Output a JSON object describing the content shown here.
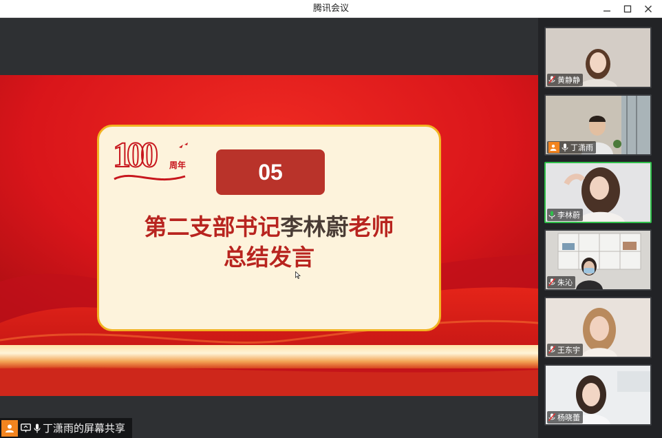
{
  "window": {
    "title": "腾讯会议",
    "controls": [
      "minimize-icon",
      "maximize-icon",
      "close-icon"
    ]
  },
  "slide": {
    "logo_number": "100",
    "logo_suffix": "周年",
    "badge": "05",
    "heading_line1_a": "第二支部书记",
    "heading_line1_b": "李林蔚",
    "heading_line1_c": "老师",
    "heading_line2": "总结发言",
    "colors": {
      "red": "#c7161d",
      "card": "#fdf3dc",
      "gold": "#f2b323",
      "badge": "#b9332a"
    }
  },
  "share": {
    "label": "丁潇雨的屏幕共享"
  },
  "participants": [
    {
      "name": "黄静静",
      "mic": "muted",
      "host": false,
      "active": false
    },
    {
      "name": "丁潇雨",
      "mic": "on",
      "host": true,
      "active": false
    },
    {
      "name": "李林蔚",
      "mic": "speaking",
      "host": false,
      "active": true
    },
    {
      "name": "朱沁",
      "mic": "muted",
      "host": false,
      "active": false
    },
    {
      "name": "王东宇",
      "mic": "muted",
      "host": false,
      "active": false
    },
    {
      "name": "杨晓蕾",
      "mic": "muted",
      "host": false,
      "active": false
    }
  ]
}
